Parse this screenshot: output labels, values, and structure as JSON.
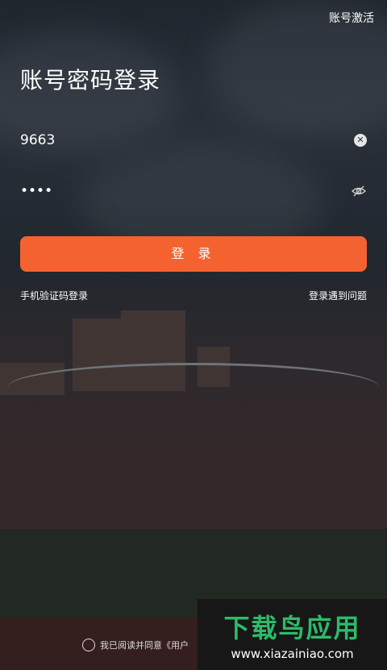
{
  "header": {
    "activate_label": "账号激活",
    "title": "账号密码登录"
  },
  "form": {
    "account_value": "9663",
    "password_value": "••••",
    "login_label": "登 录"
  },
  "links": {
    "sms_login": "手机验证码登录",
    "help": "登录遇到问题"
  },
  "agreement": {
    "text": "我已阅读并同意《用户"
  },
  "watermark": {
    "brand": "下载鸟应用",
    "url": "www.xiazainiao.com"
  },
  "colors": {
    "accent": "#f4622f"
  },
  "icons": {
    "clear": "clear-icon",
    "password_toggle": "eye-off-icon"
  }
}
